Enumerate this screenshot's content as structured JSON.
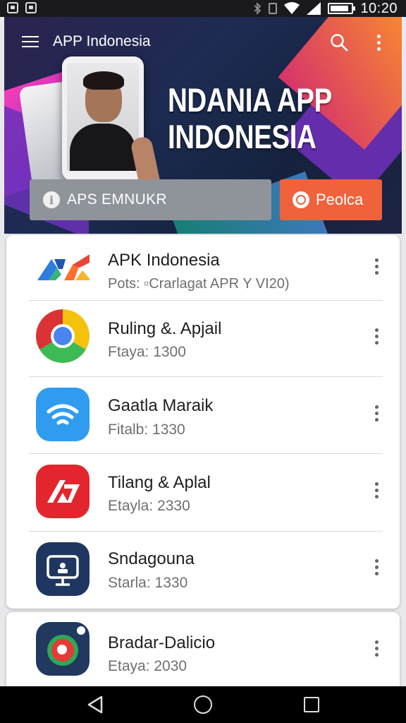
{
  "status_bar": {
    "time": "10:20",
    "icons": [
      "screenshot-icon",
      "image-icon",
      "bluetooth-icon",
      "vibrate-icon",
      "wifi-icon",
      "signal-icon",
      "battery-icon"
    ],
    "battery_level": 0.9
  },
  "header": {
    "title": "APP Indonesia",
    "hero_line1": "NDANIA APP",
    "hero_line2": "INDONESIA",
    "info_button_label": "APS EMNUKR",
    "accent_button_label": "Peolca",
    "accent_color": "#f0623c"
  },
  "apps": [
    {
      "title": "APK Indonesia",
      "subtitle": "Pots: ▫Crarlagat APR Y VI20)",
      "icon": "apk-indonesia-logo"
    },
    {
      "title": "Ruling &. Apjail",
      "subtitle": "Ftaya: 1300",
      "icon": "chrome-icon"
    },
    {
      "title": "Gaatla Maraik",
      "subtitle": "Fitalb: 1330",
      "icon": "wifi-app-icon"
    },
    {
      "title": "Tilang & Aplal",
      "subtitle": "Etayla: 2330",
      "icon": "red-app-icon"
    },
    {
      "title": "Sndagouna",
      "subtitle": "Starla: 1330",
      "icon": "monitor-app-icon"
    },
    {
      "title": "Bradar-Dalicio",
      "subtitle": "Etaya: 2030",
      "icon": "red-circle-app-icon"
    }
  ],
  "nav": {
    "back": "back-icon",
    "home": "home-icon",
    "recents": "recents-icon"
  }
}
